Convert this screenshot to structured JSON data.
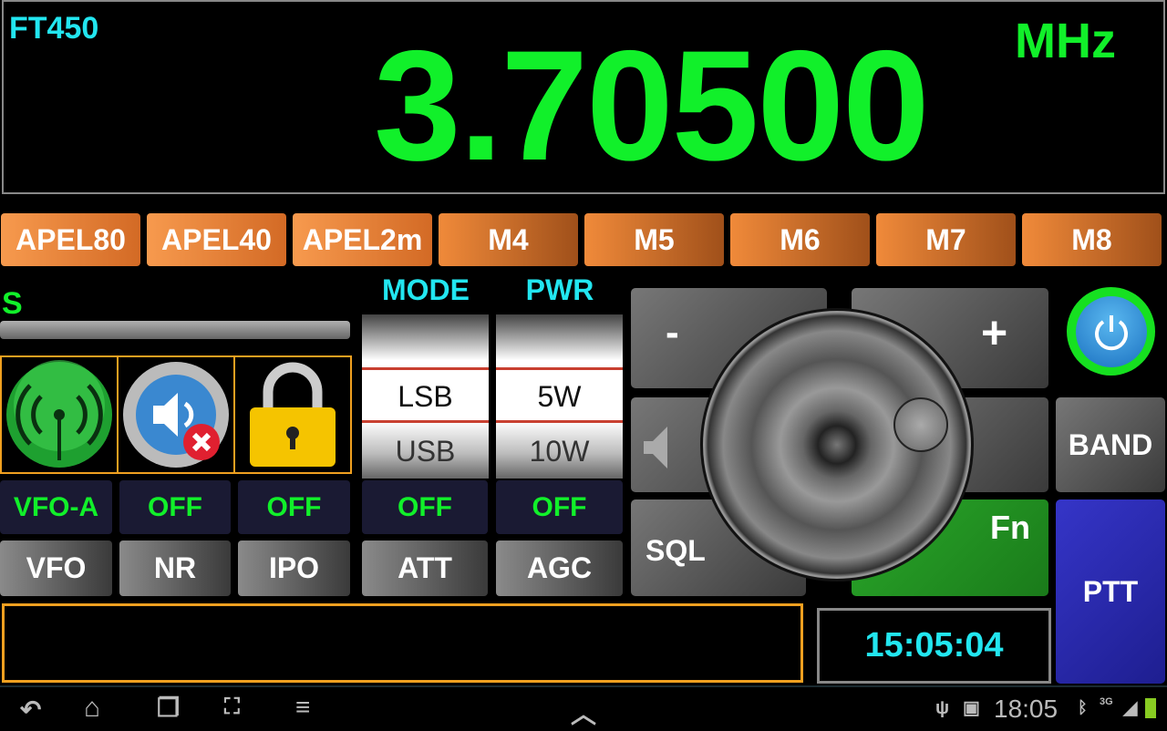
{
  "header": {
    "model": "FT450",
    "frequency": "3.70500",
    "unit": "MHz"
  },
  "memories": [
    "APEL80",
    "APEL40",
    "APEL2m",
    "M4",
    "M5",
    "M6",
    "M7",
    "M8"
  ],
  "meter": {
    "label": "S",
    "level": 0
  },
  "icons": [
    "antenna-icon",
    "speaker-mute-icon",
    "lock-icon"
  ],
  "columns": {
    "mode_label": "MODE",
    "pwr_label": "PWR",
    "mode_selected": "LSB",
    "mode_next": "USB",
    "pwr_selected": "5W",
    "pwr_next": "10W"
  },
  "status": [
    "VFO-A",
    "OFF",
    "OFF",
    "OFF",
    "OFF"
  ],
  "buttons": [
    "VFO",
    "NR",
    "IPO",
    "ATT",
    "AGC"
  ],
  "controls": {
    "minus": "-",
    "plus": "+",
    "sql": "SQL",
    "fn": "Fn",
    "band": "BAND",
    "ptt": "PTT"
  },
  "clock": "15:05:04",
  "statusbar": {
    "time": "18:05",
    "network": "3G"
  },
  "colors": {
    "green": "#11f02a",
    "cyan": "#22e6f0",
    "orange": "#f0a020",
    "ptt": "#2a2ab8",
    "fn": "#229922"
  }
}
